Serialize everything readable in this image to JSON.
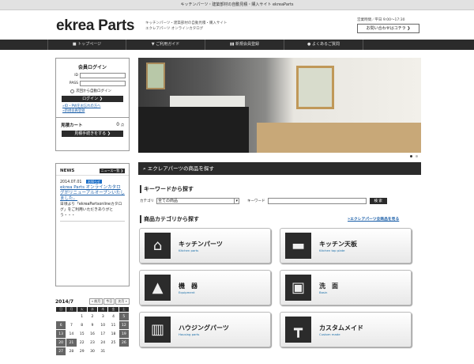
{
  "topbar": "キッチンパーツ・建築部材の自動見積・購入サイト ekreaParts",
  "header": {
    "logo": "ekrea Parts",
    "tagline1": "キッチンパーツ・建築部材の自動見積・購入サイト",
    "tagline2": "エクレアパーツ オンラインカタログ",
    "hours": "営業時間／平日 9:00〜17:30",
    "contact": "お問い合わせはコチラ ❯"
  },
  "nav": [
    {
      "icon": "home-icon",
      "label": "トップページ"
    },
    {
      "icon": "guide-icon",
      "label": "ご利用ガイド"
    },
    {
      "icon": "users-icon",
      "label": "新規会員登録"
    },
    {
      "icon": "help-icon",
      "label": "よくあるご質問"
    }
  ],
  "login": {
    "title": "会員ログイン",
    "id_label": "ID",
    "pass_label": "PASS",
    "remember": "次回から自動ログイン",
    "button": "ログイン ❯",
    "forgot": "»ID・PWをお忘れの方へ",
    "register": "»新規会員登録"
  },
  "cart": {
    "title": "見積カート",
    "count": "0",
    "unit": "点",
    "button": "見積手続きをする ❯"
  },
  "news": {
    "title": "NEWS",
    "list_button": "ニュース一覧 ❯",
    "date": "2014.07.01",
    "badge": "お知らせ",
    "headline": "ekrea Parts オンラインカタログがリニューアルオープンいたしました。",
    "body": "日頃より「ekreaPartsonlineカタログ」をご利用いただきありがとう・・・"
  },
  "calendar": {
    "month": "2014/7",
    "prev": "« 前月",
    "today": "今日",
    "next": "次月 »",
    "weekdays": [
      "日",
      "月",
      "火",
      "水",
      "木",
      "金",
      "土"
    ],
    "weeks": [
      [
        "",
        "",
        "1",
        "2",
        "3",
        "4",
        "5"
      ],
      [
        "6",
        "7",
        "8",
        "9",
        "10",
        "11",
        "12"
      ],
      [
        "13",
        "14",
        "15",
        "16",
        "17",
        "18",
        "19"
      ],
      [
        "20",
        "21",
        "22",
        "23",
        "24",
        "25",
        "26"
      ],
      [
        "27",
        "28",
        "29",
        "30",
        "31",
        "",
        ""
      ]
    ],
    "holidays": [
      "5",
      "6",
      "12",
      "13",
      "19",
      "20",
      "21",
      "26",
      "27"
    ]
  },
  "search": {
    "bar_title": "エクレアパーツの商品を探す",
    "keyword_title": "キーワードから探す",
    "category_label": "カテゴリ",
    "category_value": "全ての商品",
    "keyword_label": "キーワード",
    "keyword_value": "",
    "button": "検 索",
    "cat_title": "商品カテゴリから探す",
    "all_link": "»エクレアパーツ全商品を見る"
  },
  "categories": [
    {
      "ja": "キッチンパーツ",
      "en": "Kitchen parts"
    },
    {
      "ja": "キッチン天板",
      "en": "Kitchen top plate"
    },
    {
      "ja": "機　器",
      "en": "Equipment"
    },
    {
      "ja": "洗　面",
      "en": "Basin"
    },
    {
      "ja": "ハウジングパーツ",
      "en": "Housing parts"
    },
    {
      "ja": "カスタムメイド",
      "en": "Custom made"
    }
  ]
}
